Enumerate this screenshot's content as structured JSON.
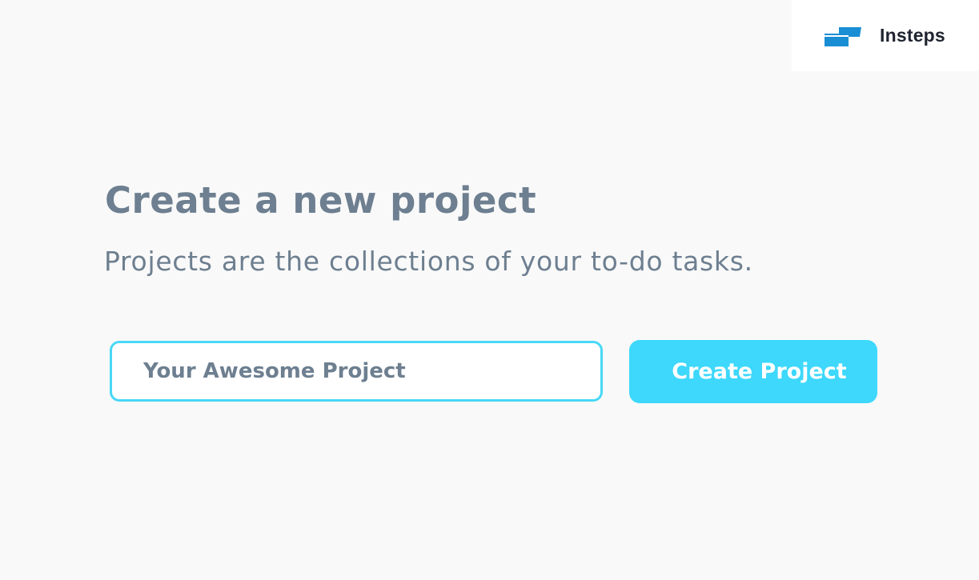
{
  "brand": {
    "name": "Insteps",
    "logo_icon": "stairs-logo-icon",
    "logo_color": "#1a8ed4"
  },
  "main": {
    "title": "Create a new project",
    "subtitle": "Projects are the collections of your to-do tasks."
  },
  "form": {
    "project_name_placeholder": "Your Awesome Project",
    "project_name_value": "",
    "submit_label": "Create Project",
    "input_border_color": "#48d8f6",
    "button_color": "#3dd8fc"
  },
  "colors": {
    "background": "#f9f9f9",
    "text": "#6d7f90"
  }
}
